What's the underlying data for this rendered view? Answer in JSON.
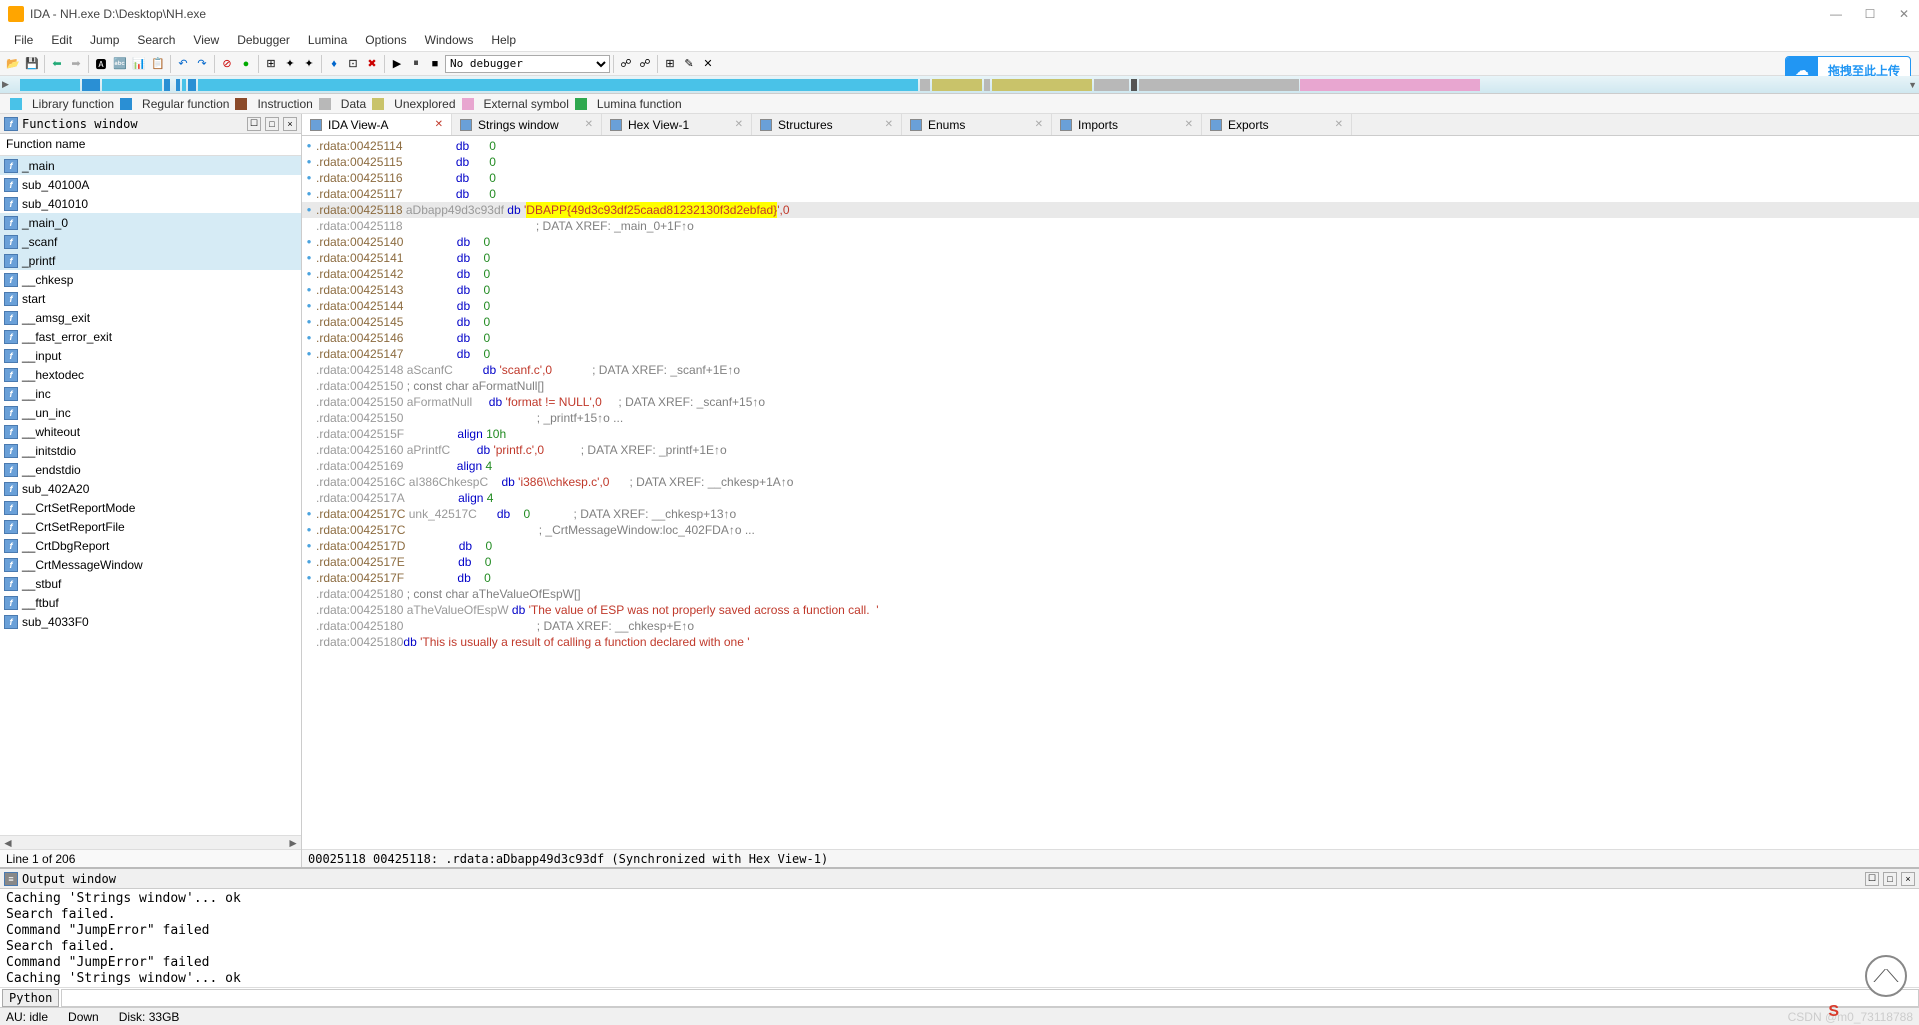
{
  "window": {
    "title": "IDA - NH.exe D:\\Desktop\\NH.exe"
  },
  "menu": [
    "File",
    "Edit",
    "Jump",
    "Search",
    "View",
    "Debugger",
    "Lumina",
    "Options",
    "Windows",
    "Help"
  ],
  "toolbar": {
    "debugger_select": "No debugger"
  },
  "upload": "拖拽至此上传",
  "legend": [
    {
      "color": "#49c2e8",
      "label": "Library function"
    },
    {
      "color": "#2a8fd4",
      "label": "Regular function"
    },
    {
      "color": "#8b4a2a",
      "label": "Instruction"
    },
    {
      "color": "#b8b8b8",
      "label": "Data"
    },
    {
      "color": "#c9c36a",
      "label": "Unexplored"
    },
    {
      "color": "#e8a6d0",
      "label": "External symbol"
    },
    {
      "color": "#2fa84f",
      "label": "Lumina function"
    }
  ],
  "functions": {
    "title": "Functions window",
    "header": "Function name",
    "status": "Line 1 of 206",
    "items": [
      {
        "name": "_main",
        "sel": true
      },
      {
        "name": "sub_40100A"
      },
      {
        "name": "sub_401010"
      },
      {
        "name": "_main_0",
        "sel": true
      },
      {
        "name": "_scanf",
        "sel": true
      },
      {
        "name": "_printf",
        "sel": true
      },
      {
        "name": "__chkesp"
      },
      {
        "name": "start"
      },
      {
        "name": "__amsg_exit"
      },
      {
        "name": "__fast_error_exit"
      },
      {
        "name": "__input"
      },
      {
        "name": "__hextodec"
      },
      {
        "name": "__inc"
      },
      {
        "name": "__un_inc"
      },
      {
        "name": "__whiteout"
      },
      {
        "name": "__initstdio"
      },
      {
        "name": "__endstdio"
      },
      {
        "name": "sub_402A20"
      },
      {
        "name": "__CrtSetReportMode"
      },
      {
        "name": "__CrtSetReportFile"
      },
      {
        "name": "__CrtDbgReport"
      },
      {
        "name": "__CrtMessageWindow"
      },
      {
        "name": "__stbuf"
      },
      {
        "name": "__ftbuf"
      },
      {
        "name": "sub_4033F0"
      }
    ]
  },
  "tabs": [
    {
      "label": "IDA View-A",
      "icon": "#6aa0d8",
      "active": true,
      "close": "red"
    },
    {
      "label": "Strings window",
      "icon": "#6aa0d8",
      "close": "gray"
    },
    {
      "label": "Hex View-1",
      "icon": "#6aa0d8",
      "close": "gray"
    },
    {
      "label": "Structures",
      "icon": "#6aa0d8",
      "close": "gray"
    },
    {
      "label": "Enums",
      "icon": "#6aa0d8",
      "close": "gray"
    },
    {
      "label": "Imports",
      "icon": "#6aa0d8",
      "close": "gray"
    },
    {
      "label": "Exports",
      "icon": "#6aa0d8",
      "close": "gray"
    }
  ],
  "code": [
    {
      "dot": true,
      "addr": ".rdata:00425114",
      "body": "                db      0"
    },
    {
      "dot": true,
      "addr": ".rdata:00425115",
      "body": "                db      0"
    },
    {
      "dot": true,
      "addr": ".rdata:00425116",
      "body": "                db      0"
    },
    {
      "dot": true,
      "addr": ".rdata:00425117",
      "body": "                db      0"
    },
    {
      "dot": true,
      "sel": true,
      "addr": ".rdata:00425118",
      "sym": " aDbapp49d3c93df ",
      "kw": "db ",
      "q": "'",
      "hl": "DBAPP{49d3c93df25caad81232130f3d2ebfad}",
      "tail": "',0"
    },
    {
      "gray": true,
      "addr": ".rdata:00425118",
      "cmt": "                                        ; DATA XREF: _main_0+1F↑o"
    },
    {
      "dot": true,
      "addr": ".rdata:00425140",
      "body": "                db    0"
    },
    {
      "dot": true,
      "addr": ".rdata:00425141",
      "body": "                db    0"
    },
    {
      "dot": true,
      "addr": ".rdata:00425142",
      "body": "                db    0"
    },
    {
      "dot": true,
      "addr": ".rdata:00425143",
      "body": "                db    0"
    },
    {
      "dot": true,
      "addr": ".rdata:00425144",
      "body": "                db    0"
    },
    {
      "dot": true,
      "addr": ".rdata:00425145",
      "body": "                db    0"
    },
    {
      "dot": true,
      "addr": ".rdata:00425146",
      "body": "                db    0"
    },
    {
      "dot": true,
      "addr": ".rdata:00425147",
      "body": "                db    0"
    },
    {
      "gray": true,
      "addr": ".rdata:00425148",
      "sym": " aScanfC         ",
      "kw": "db ",
      "str": "'scanf.c'",
      "tail": ",0",
      "cmt": "            ; DATA XREF: _scanf+1E↑o"
    },
    {
      "gray": true,
      "addr": ".rdata:00425150",
      "cmt": " ; const char aFormatNull[]"
    },
    {
      "gray": true,
      "addr": ".rdata:00425150",
      "sym": " aFormatNull     ",
      "kw": "db ",
      "str": "'format != NULL'",
      "tail": ",0",
      "cmt": "     ; DATA XREF: _scanf+15↑o"
    },
    {
      "gray": true,
      "addr": ".rdata:00425150",
      "cmt": "                                        ; _printf+15↑o ..."
    },
    {
      "gray": true,
      "addr": ".rdata:0042515F",
      "body": "                align 10h"
    },
    {
      "gray": true,
      "addr": ".rdata:00425160",
      "sym": " aPrintfC        ",
      "kw": "db ",
      "str": "'printf.c'",
      "tail": ",0",
      "cmt": "           ; DATA XREF: _printf+1E↑o"
    },
    {
      "gray": true,
      "addr": ".rdata:00425169",
      "body": "                align 4"
    },
    {
      "gray": true,
      "addr": ".rdata:0042516C",
      "sym": " aI386ChkespC    ",
      "kw": "db ",
      "str": "'i386\\\\chkesp.c'",
      "tail": ",0",
      "cmt": "      ; DATA XREF: __chkesp+1A↑o"
    },
    {
      "gray": true,
      "addr": ".rdata:0042517A",
      "body": "                align 4"
    },
    {
      "dot": true,
      "addr": ".rdata:0042517C",
      "sym": " unk_42517C",
      "body": "      db    0",
      "cmt": "             ; DATA XREF: __chkesp+13↑o"
    },
    {
      "dot": true,
      "addr": ".rdata:0042517C",
      "cmt": "                                        ; _CrtMessageWindow:loc_402FDA↑o ..."
    },
    {
      "dot": true,
      "addr": ".rdata:0042517D",
      "body": "                db    0"
    },
    {
      "dot": true,
      "addr": ".rdata:0042517E",
      "body": "                db    0"
    },
    {
      "dot": true,
      "addr": ".rdata:0042517F",
      "body": "                db    0"
    },
    {
      "gray": true,
      "addr": ".rdata:00425180",
      "cmt": " ; const char aTheValueOfEspW[]"
    },
    {
      "gray": true,
      "addr": ".rdata:00425180",
      "sym": " aTheValueOfEspW ",
      "kw": "db ",
      "str": "'The value of ESP was not properly saved across a function call.  '"
    },
    {
      "gray": true,
      "addr": ".rdata:00425180",
      "cmt": "                                        ; DATA XREF: __chkesp+E↑o"
    },
    {
      "gray": true,
      "addr": ".rdata:00425180",
      "body": "                ",
      "kw": "db ",
      "str": "'This is usually a result of calling a function declared with one '"
    }
  ],
  "sync": "00025118 00425118: .rdata:aDbapp49d3c93df (Synchronized with Hex View-1)",
  "output": {
    "title": "Output window",
    "lines": [
      "Caching 'Strings window'... ok",
      "Search failed.",
      "Command \"JumpError\" failed",
      "Search failed.",
      "Command \"JumpError\" failed",
      "Caching 'Strings window'... ok"
    ],
    "prompt": "Python"
  },
  "status": {
    "au": "AU: idle",
    "down": "Down",
    "disk": "Disk: 33GB",
    "watermark": "CSDN @m0_73118788"
  }
}
